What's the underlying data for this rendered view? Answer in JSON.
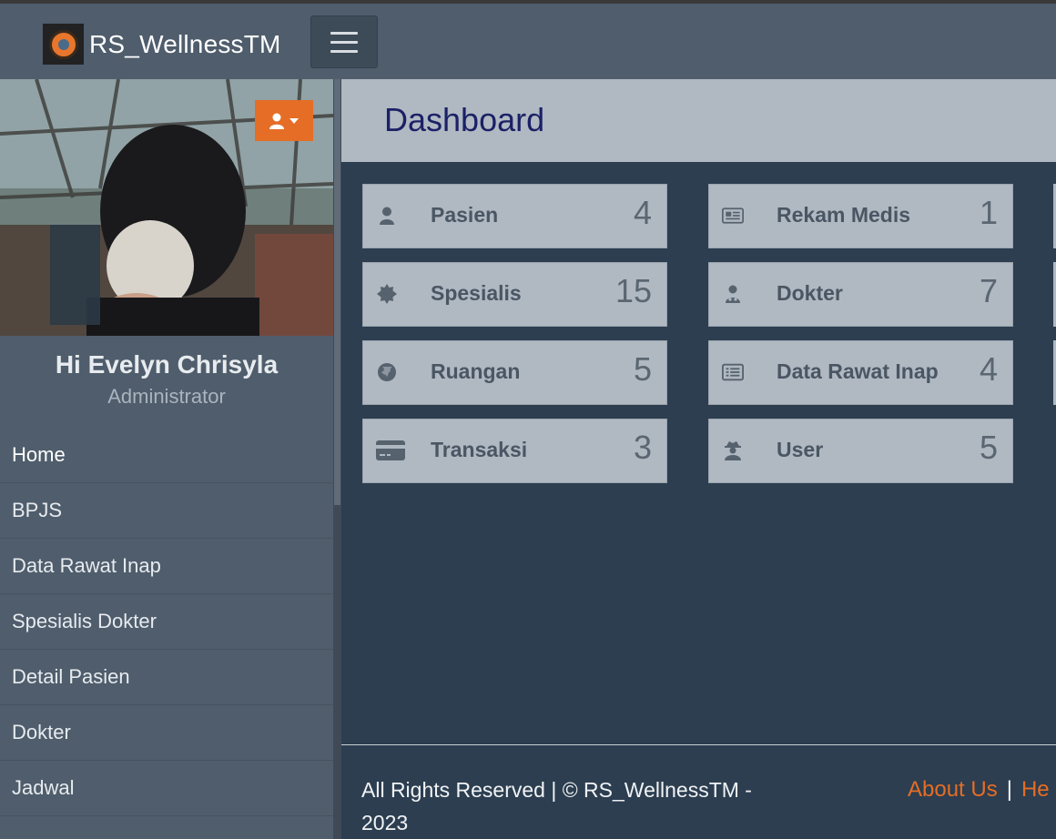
{
  "brand": {
    "title": "RS_WellnessTM"
  },
  "sidebar": {
    "greeting": "Hi Evelyn Chrisyla",
    "role": "Administrator",
    "items": [
      {
        "label": "Home"
      },
      {
        "label": "BPJS"
      },
      {
        "label": "Data Rawat Inap"
      },
      {
        "label": "Spesialis Dokter"
      },
      {
        "label": "Detail Pasien"
      },
      {
        "label": "Dokter"
      },
      {
        "label": "Jadwal"
      }
    ]
  },
  "main": {
    "title": "Dashboard",
    "cards": [
      {
        "label": "Pasien",
        "count": "4",
        "icon": "user-icon"
      },
      {
        "label": "Rekam Medis",
        "count": "1",
        "icon": "newspaper-icon"
      },
      {
        "label": "Spesialis",
        "count": "15",
        "icon": "certificate-icon"
      },
      {
        "label": "Dokter",
        "count": "7",
        "icon": "doctor-icon"
      },
      {
        "label": "Ruangan",
        "count": "5",
        "icon": "globe-icon"
      },
      {
        "label": "Data Rawat Inap",
        "count": "4",
        "icon": "list-alt-icon"
      },
      {
        "label": "Transaksi",
        "count": "3",
        "icon": "credit-card-icon"
      },
      {
        "label": "User",
        "count": "5",
        "icon": "user-secret-icon"
      }
    ]
  },
  "footer": {
    "copyright": "All Rights Reserved | © RS_WellnessTM - 2023",
    "about": "About Us",
    "separator": "|",
    "help": "He"
  },
  "colors": {
    "accent": "#e56d25",
    "navbar": "#4f5d6c",
    "content_bg": "#2c3e50",
    "card_bg": "#b0b8c2",
    "title": "#1b2166"
  }
}
